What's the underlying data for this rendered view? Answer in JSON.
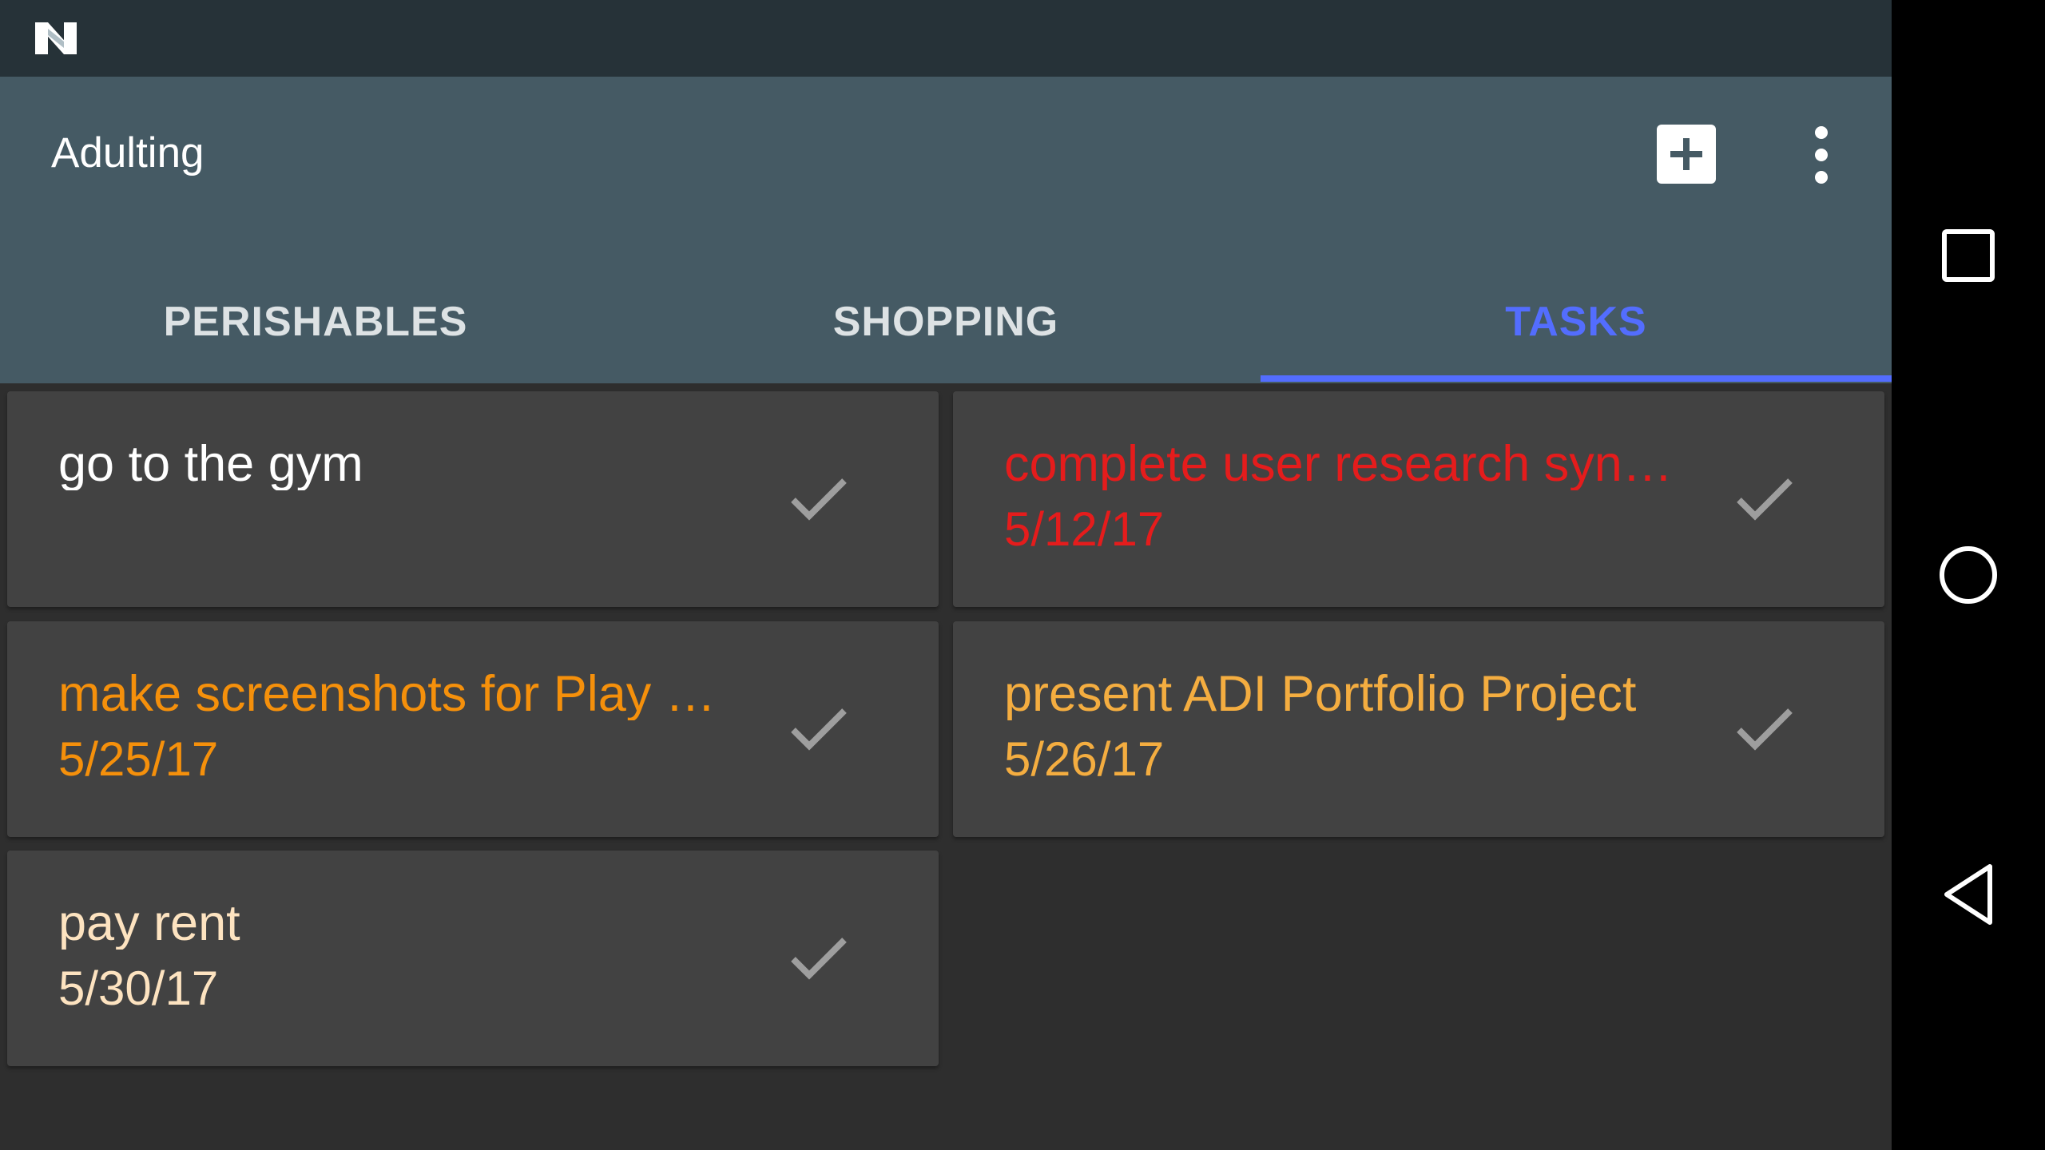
{
  "app": {
    "title": "Adulting"
  },
  "tabs": [
    {
      "label": "PERISHABLES",
      "selected": false
    },
    {
      "label": "SHOPPING",
      "selected": false
    },
    {
      "label": "TASKS",
      "selected": true
    }
  ],
  "tasks": [
    {
      "title": "go to the gym",
      "date": "",
      "color": "#ffffff"
    },
    {
      "title": "complete user research syn…",
      "date": "5/12/17",
      "color": "#e51c1c"
    },
    {
      "title": "make screenshots for Play …",
      "date": "5/25/17",
      "color": "#f5900b"
    },
    {
      "title": "present ADI Portfolio Project",
      "date": "5/26/17",
      "color": "#f4ad40"
    },
    {
      "title": "pay rent",
      "date": "5/30/17",
      "color": "#fde3c0"
    }
  ],
  "colors": {
    "status_bar": "#263238",
    "app_bar": "#455a64",
    "background": "#2e2e2e",
    "card": "#424242",
    "tab_selected": "#536dfe",
    "tab_unselected": "#dde2e4",
    "check": "#9e9e9e"
  },
  "icons": {
    "status": "android-n-logo-icon",
    "add": "add-box-icon",
    "more": "more-vertical-icon",
    "check": "check-icon",
    "nav_recents": "square-icon",
    "nav_home": "circle-icon",
    "nav_back": "triangle-back-icon"
  }
}
